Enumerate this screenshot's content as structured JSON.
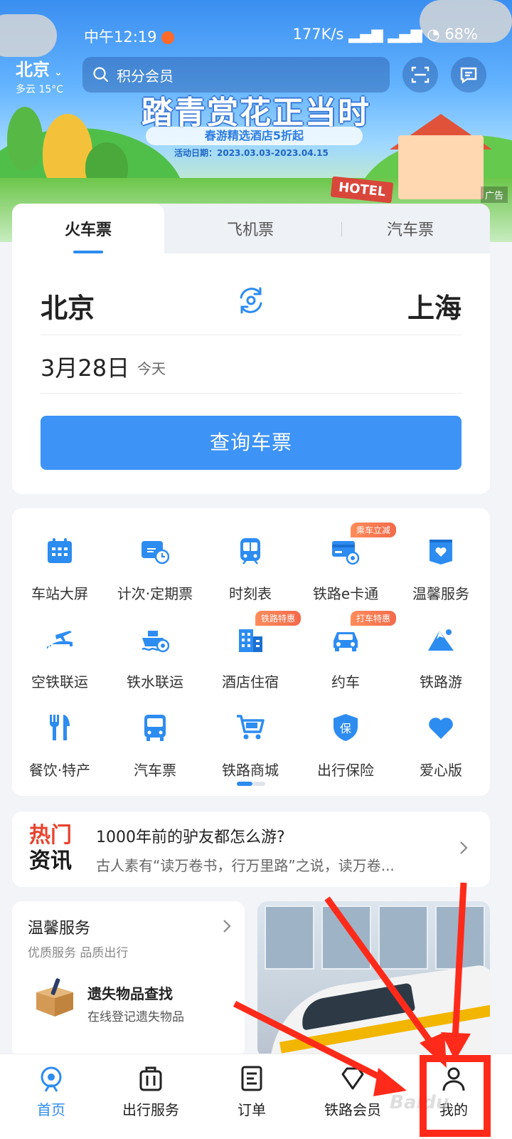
{
  "status_bar": {
    "time": "中午12:19",
    "indicators": "177K/s",
    "battery": "68%"
  },
  "header": {
    "city": "北京",
    "weather": "多云 15°C",
    "search_placeholder": "积分会员",
    "icons": [
      "scan-icon",
      "message-icon"
    ]
  },
  "banner": {
    "title": "踏青赏花正当时",
    "subtitle": "春游精选酒店5折起",
    "date": "活动日期：2023.03.03-2023.04.15",
    "sign": "HOTEL",
    "ad_label": "广告"
  },
  "ticket": {
    "tabs": [
      "火车票",
      "飞机票",
      "汽车票"
    ],
    "active_tab": 0,
    "from": "北京",
    "to": "上海",
    "date": "3月28日",
    "date_note": "今天",
    "query_label": "查询车票"
  },
  "services": [
    {
      "label": "车站大屏",
      "icon": "calendar-icon"
    },
    {
      "label": "计次·定期票",
      "icon": "ticket-clock-icon"
    },
    {
      "label": "时刻表",
      "icon": "train-icon"
    },
    {
      "label": "铁路e卡通",
      "icon": "card-icon",
      "badge": "乘车立减"
    },
    {
      "label": "温馨服务",
      "icon": "heart-bag-icon"
    },
    {
      "label": "空铁联运",
      "icon": "plane-train-icon"
    },
    {
      "label": "铁水联运",
      "icon": "ship-icon"
    },
    {
      "label": "酒店住宿",
      "icon": "hotel-icon",
      "badge": "铁路特惠"
    },
    {
      "label": "约车",
      "icon": "car-icon",
      "badge": "打车特惠"
    },
    {
      "label": "铁路游",
      "icon": "mountain-icon"
    },
    {
      "label": "餐饮·特产",
      "icon": "cutlery-icon"
    },
    {
      "label": "汽车票",
      "icon": "bus-icon"
    },
    {
      "label": "铁路商城",
      "icon": "cart-icon"
    },
    {
      "label": "出行保险",
      "icon": "shield-icon"
    },
    {
      "label": "爱心版",
      "icon": "heart-icon"
    }
  ],
  "news": {
    "label_line1": "热门",
    "label_line2": "资讯",
    "title": "1000年前的驴友都怎么游?",
    "summary": "古人素有“读万卷书，行万里路”之说，读万卷..."
  },
  "warm_service": {
    "title": "温馨服务",
    "subtitle": "优质服务 品质出行",
    "item_title": "遗失物品查找",
    "item_subtitle": "在线登记遗失物品"
  },
  "bottom_nav": [
    {
      "label": "首页",
      "icon": "home-icon",
      "active": true
    },
    {
      "label": "出行服务",
      "icon": "luggage-icon"
    },
    {
      "label": "订单",
      "icon": "order-icon"
    },
    {
      "label": "铁路会员",
      "icon": "diamond-icon"
    },
    {
      "label": "我的",
      "icon": "user-icon"
    }
  ],
  "watermark": "Baidu",
  "colors": {
    "accent": "#2d8cf0",
    "button": "#3d93f6",
    "badge": "#f26a4b",
    "annotation": "#ff2a1a"
  }
}
